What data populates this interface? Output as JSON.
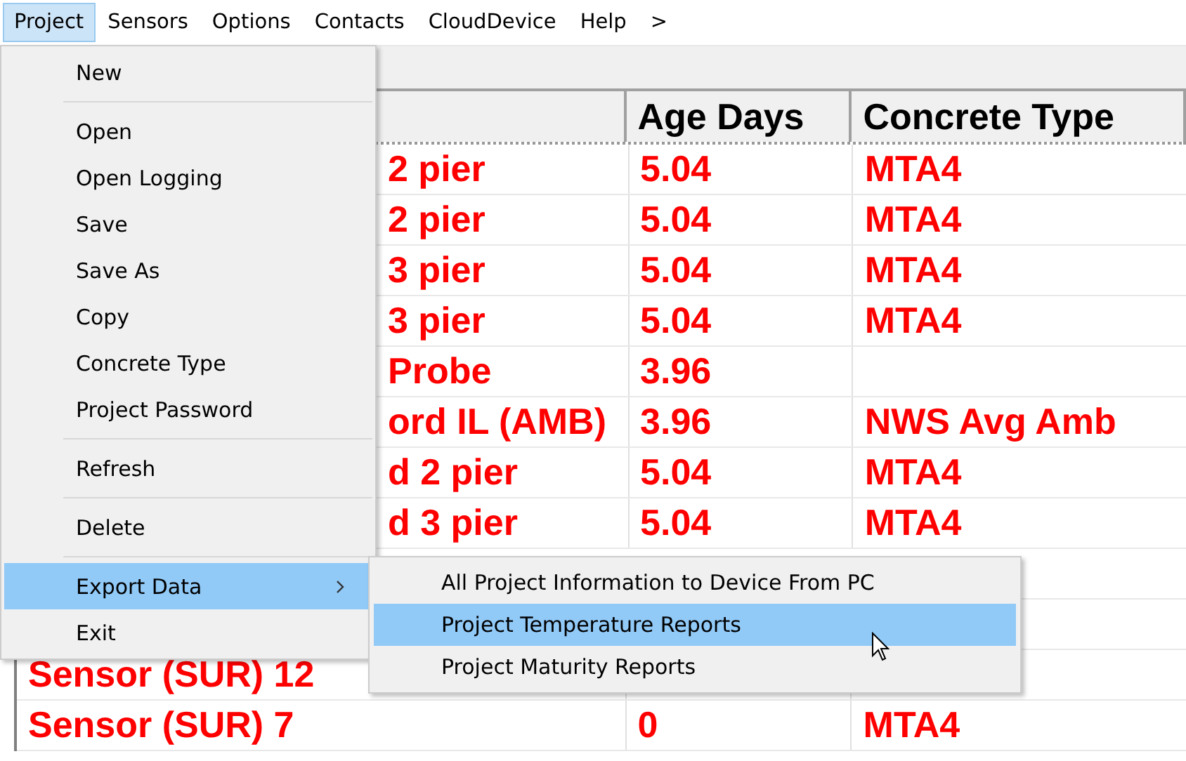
{
  "menu_bar": [
    {
      "label": "Project",
      "selected": true
    },
    {
      "label": "Sensors",
      "selected": false
    },
    {
      "label": "Options",
      "selected": false
    },
    {
      "label": "Contacts",
      "selected": false
    },
    {
      "label": "CloudDevice",
      "selected": false
    },
    {
      "label": "Help",
      "selected": false
    },
    {
      "label": ">",
      "selected": false
    }
  ],
  "table": {
    "columns": [
      "Age Days",
      "Concrete Type"
    ],
    "rows": [
      {
        "column_1": "2 pier",
        "age_days": "5.04",
        "concrete_type": "MTA4"
      },
      {
        "column_1": "2 pier",
        "age_days": "5.04",
        "concrete_type": "MTA4"
      },
      {
        "column_1": "3 pier",
        "age_days": "5.04",
        "concrete_type": "MTA4"
      },
      {
        "column_1": "3 pier",
        "age_days": "5.04",
        "concrete_type": "MTA4"
      },
      {
        "column_1": "Probe",
        "age_days": "3.96"
      },
      {
        "column_1": "ord IL (AMB)",
        "age_days": "3.96",
        "concrete_type": "NWS Avg Amb"
      },
      {
        "column_1": "d 2 pier",
        "age_days": "5.04",
        "concrete_type": "MTA4"
      },
      {
        "column_1": "d 3 pier",
        "age_days": "5.04",
        "concrete_type": "MTA4"
      }
    ],
    "lower_rows": [
      {
        "column_1": "Sensor (SUR) 12"
      },
      {
        "column_1": "Sensor (SUR) 7",
        "age_days": "0",
        "concrete_type": "MTA4"
      }
    ]
  },
  "project_menu": [
    {
      "kind": "item",
      "label": "New",
      "selected": false
    },
    {
      "kind": "separator"
    },
    {
      "kind": "item",
      "label": "Open",
      "selected": false
    },
    {
      "kind": "item",
      "label": "Open Logging",
      "selected": false
    },
    {
      "kind": "item",
      "label": "Save",
      "selected": false
    },
    {
      "kind": "item",
      "label": "Save As",
      "selected": false
    },
    {
      "kind": "item",
      "label": "Copy",
      "selected": false
    },
    {
      "kind": "item",
      "label": "Concrete Type",
      "selected": false
    },
    {
      "kind": "item",
      "label": "Project Password",
      "selected": false
    },
    {
      "kind": "separator"
    },
    {
      "kind": "item",
      "label": "Refresh",
      "selected": false
    },
    {
      "kind": "separator"
    },
    {
      "kind": "item",
      "label": "Delete",
      "selected": false
    },
    {
      "kind": "separator"
    },
    {
      "kind": "submenu",
      "label": "Export Data",
      "selected": true
    },
    {
      "kind": "item",
      "label": "Exit",
      "selected": false
    }
  ],
  "export_submenu": [
    {
      "label": "All Project Information to Device From PC",
      "selected": false
    },
    {
      "label": "Project Temperature Reports",
      "selected": true
    },
    {
      "label": "Project Maturity Reports",
      "selected": false
    }
  ]
}
